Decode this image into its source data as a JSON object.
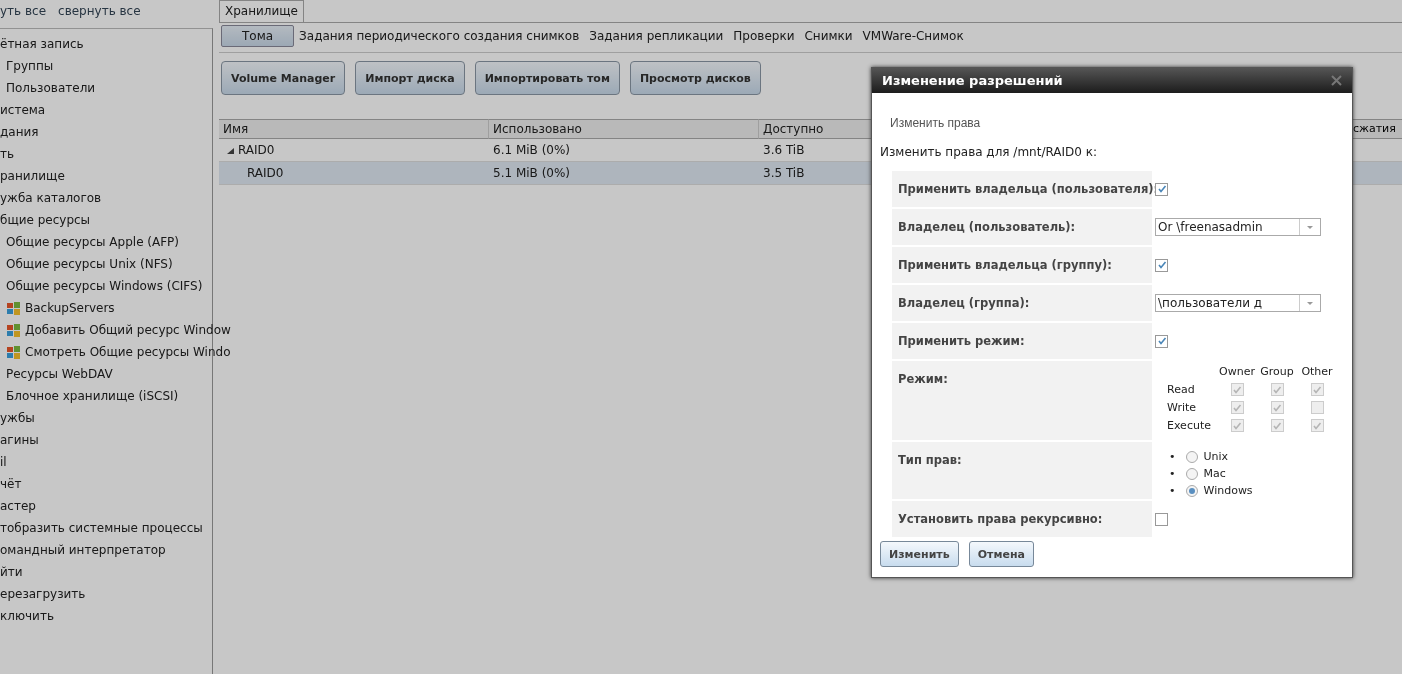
{
  "sidebar": {
    "links": [
      "уть все",
      "свернуть все"
    ],
    "items": [
      {
        "label": "ётная запись",
        "children": [
          {
            "label": "Группы"
          },
          {
            "label": "Пользователи"
          }
        ]
      },
      {
        "label": "истема"
      },
      {
        "label": "дания"
      },
      {
        "label": "ть"
      },
      {
        "label": "ранилище"
      },
      {
        "label": "ужба каталогов"
      },
      {
        "label": "бщие ресурсы",
        "children": [
          {
            "label": "Общие ресурсы Apple (AFP)"
          },
          {
            "label": "Общие ресурсы Unix (NFS)"
          },
          {
            "label": "Общие ресурсы Windows (CIFS)",
            "children": [
              {
                "label": "BackupServers"
              },
              {
                "label": "Добавить Общий ресурс Window"
              },
              {
                "label": "Смотреть Общие ресурсы Windo"
              }
            ]
          },
          {
            "label": "Ресурсы WebDAV"
          },
          {
            "label": "Блочное хранилище (iSCSI)"
          }
        ]
      },
      {
        "label": "ужбы"
      },
      {
        "label": "агины"
      },
      {
        "label": "il"
      },
      {
        "label": "чёт"
      },
      {
        "label": "астер"
      },
      {
        "label": "тобразить системные процессы"
      },
      {
        "label": "омандный интерпретатор"
      },
      {
        "label": "йти"
      },
      {
        "label": "ерезагрузить"
      },
      {
        "label": "ключить"
      }
    ]
  },
  "tabs": [
    {
      "label": "Хранилище",
      "selected": true
    }
  ],
  "subtabs": [
    {
      "label": "Тома",
      "selected": true
    },
    {
      "label": "Задания периодического создания снимков",
      "selected": false
    },
    {
      "label": "Задания репликации",
      "selected": false
    },
    {
      "label": "Проверки",
      "selected": false
    },
    {
      "label": "Снимки",
      "selected": false
    },
    {
      "label": "VMWare-Снимок",
      "selected": false
    }
  ],
  "buttons": [
    "Volume Manager",
    "Импорт диска",
    "Импортировать том",
    "Просмотр дисков"
  ],
  "table": {
    "columns": [
      "Имя",
      "Использовано",
      "Доступно",
      "сжатия"
    ],
    "rows": [
      {
        "cells": [
          "RAID0",
          "6.1 MiB (0%)",
          "3.6 TiB"
        ],
        "expanded": true,
        "selected": false,
        "children": [
          {
            "cells": [
              "RAID0",
              "5.1 MiB (0%)",
              "3.5 TiB"
            ],
            "selected": true
          }
        ]
      }
    ]
  },
  "dialog": {
    "title": "Изменение разрешений",
    "section": "Изменить права",
    "intro": "Изменить права для /mnt/RAID0 к:",
    "fields": [
      {
        "kind": "checkbox",
        "label": "Применить владельца (пользователя):",
        "checked": true
      },
      {
        "kind": "select",
        "label": "Владелец (пользователь):",
        "value": "Or \\freenasadmin"
      },
      {
        "kind": "checkbox",
        "label": "Применить владельца (группу):",
        "checked": true
      },
      {
        "kind": "select",
        "label": "Владелец (группа):",
        "value": "\\пользователи д"
      },
      {
        "kind": "checkbox",
        "label": "Применить режим:",
        "checked": true
      },
      {
        "kind": "mode",
        "label": "Режим:",
        "columns": [
          "Owner",
          "Group",
          "Other"
        ],
        "rows": [
          {
            "label": "Read",
            "checked": [
              true,
              true,
              true
            ]
          },
          {
            "label": "Write",
            "checked": [
              true,
              true,
              false
            ]
          },
          {
            "label": "Execute",
            "checked": [
              true,
              true,
              true
            ]
          }
        ]
      },
      {
        "kind": "radio",
        "label": "Тип прав:",
        "bullet": "•",
        "options": [
          {
            "label": "Unix",
            "selected": false
          },
          {
            "label": "Mac",
            "selected": false
          },
          {
            "label": "Windows",
            "selected": true
          }
        ]
      },
      {
        "kind": "checkbox",
        "label": "Установить права рекурсивно:",
        "checked": false
      }
    ],
    "buttons": [
      "Изменить",
      "Отмена"
    ]
  }
}
